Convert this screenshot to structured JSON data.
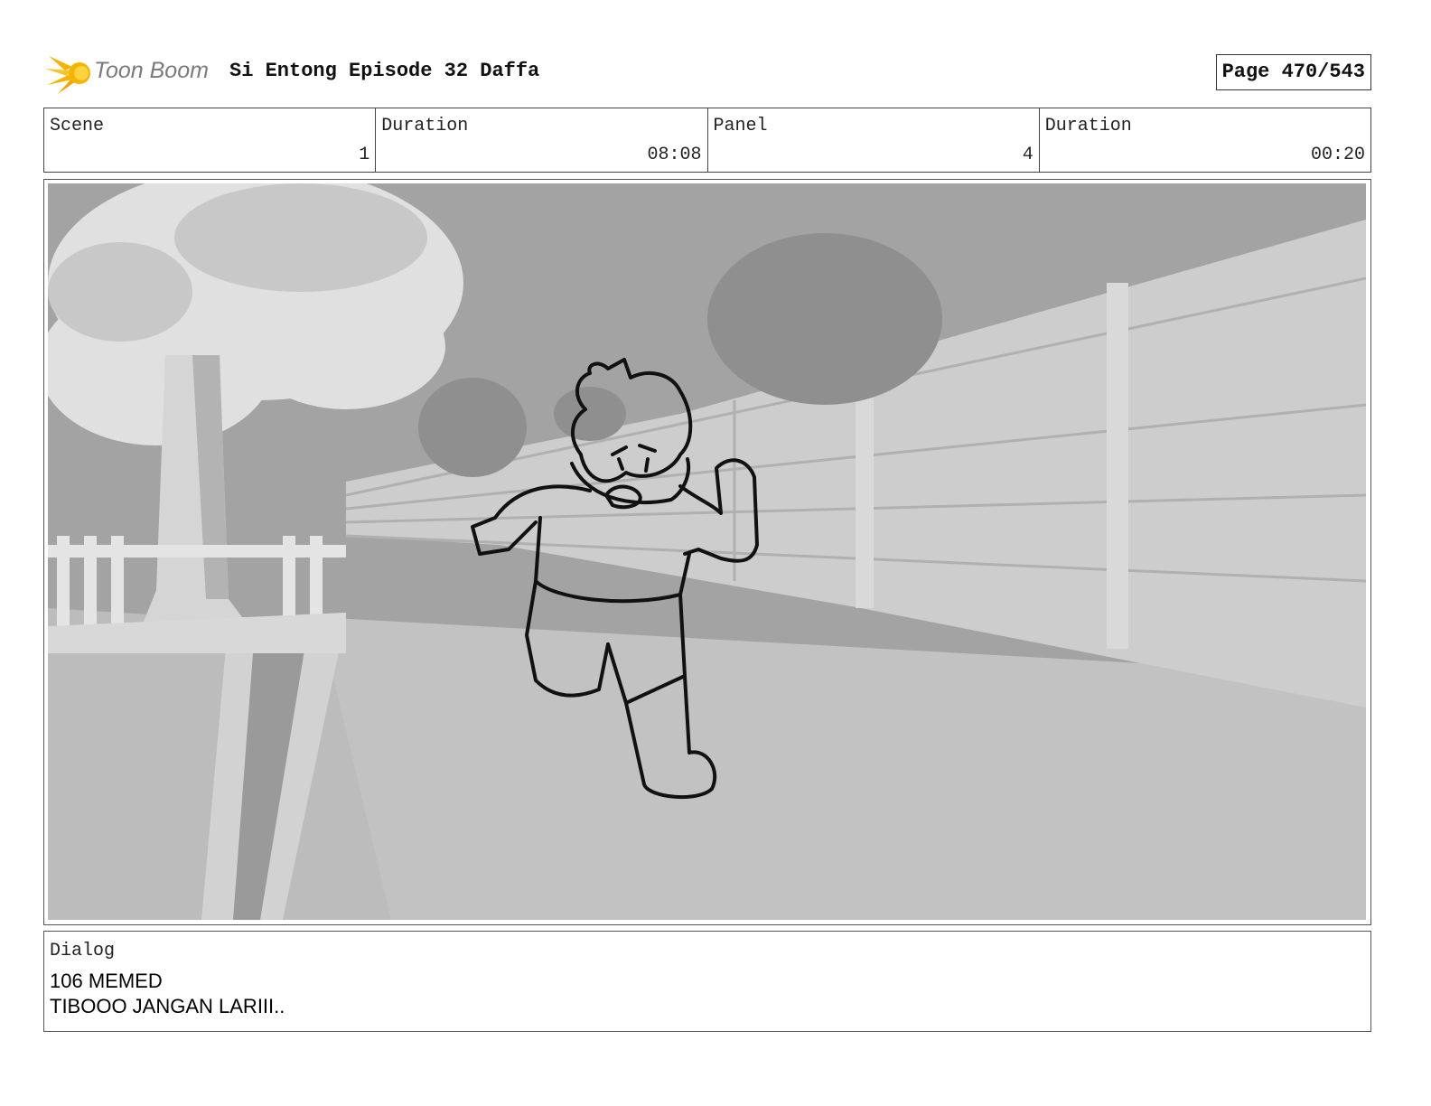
{
  "header": {
    "logo_text": "Toon Boom",
    "title": "Si Entong Episode 32 Daffa",
    "page": "Page 470/543"
  },
  "info": {
    "scene_label": "Scene",
    "scene_value": "1",
    "scene_duration_label": "Duration",
    "scene_duration_value": "08:08",
    "panel_label": "Panel",
    "panel_value": "4",
    "panel_duration_label": "Duration",
    "panel_duration_value": "00:20"
  },
  "dialog": {
    "label": "Dialog",
    "lines": [
      "106 MEMED",
      "TIBOOO JANGAN LARIII.."
    ]
  },
  "colors": {
    "logo_yellow": "#f5b400",
    "panel_sky": "#9e9e9e",
    "panel_ground": "#b9b9b9",
    "wall": "#cfcfcf"
  }
}
